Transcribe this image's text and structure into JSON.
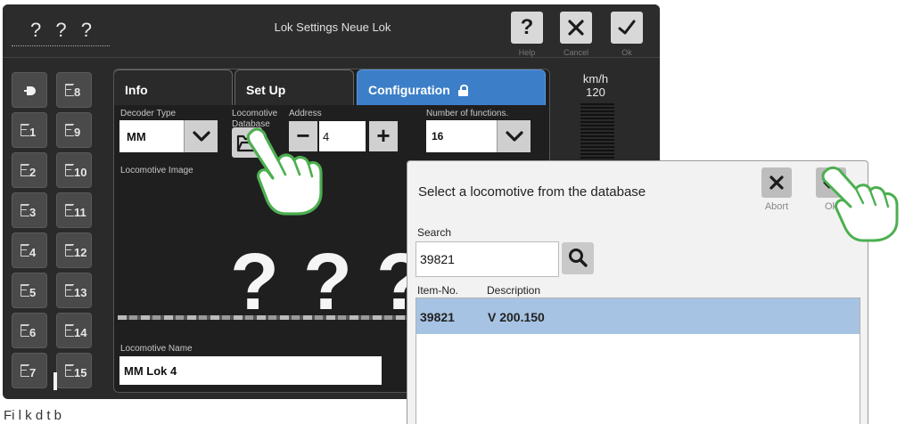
{
  "window": {
    "loco_name": "? ? ?",
    "title": "Lok Settings Neue Lok",
    "buttons": {
      "help_glyph": "?",
      "help_label": "Help",
      "cancel_label": "Cancel",
      "ok_label": "Ok"
    }
  },
  "function_keys": {
    "left": [
      "",
      "1",
      "2",
      "3",
      "4",
      "5",
      "6",
      "7"
    ],
    "right": [
      "8",
      "9",
      "10",
      "11",
      "12",
      "13",
      "14",
      "15"
    ]
  },
  "tabs": {
    "info": "Info",
    "setup": "Set Up",
    "configuration": "Configuration"
  },
  "config": {
    "decoder_type_label": "Decoder Type",
    "decoder_type_value": "MM",
    "loco_db_label": "Locomotive Database",
    "address_label": "Address",
    "address_value": "4",
    "address_minus": "−",
    "address_plus": "+",
    "functions_label": "Number of functions.",
    "functions_value": "16",
    "image_label": "Locomotive Image",
    "image_placeholder": "?",
    "name_label": "Locomotive Name",
    "name_value": "MM Lok 4"
  },
  "speed": {
    "unit": "km/h",
    "max": "120"
  },
  "dialog": {
    "title": "Select a locomotive from the database",
    "abort_label": "Abort",
    "ok_label": "Ok",
    "search_label": "Search",
    "search_value": "39821",
    "columns": [
      "Item-No.",
      "Description"
    ],
    "rows": [
      {
        "item_no": "39821",
        "description": "V 200.150"
      }
    ]
  },
  "footer_text": "Fi   l   k   d   t   b",
  "colors": {
    "accent_tab": "#3c7fc8",
    "selected_row": "#a7c3e3",
    "hand_outline": "#4caf50"
  },
  "icons": [
    "help-icon",
    "close-icon",
    "check-icon",
    "light-icon",
    "function-key-icon",
    "lock-icon",
    "folder-database-icon",
    "chevron-down-icon",
    "search-icon",
    "pointing-hand-icon"
  ]
}
